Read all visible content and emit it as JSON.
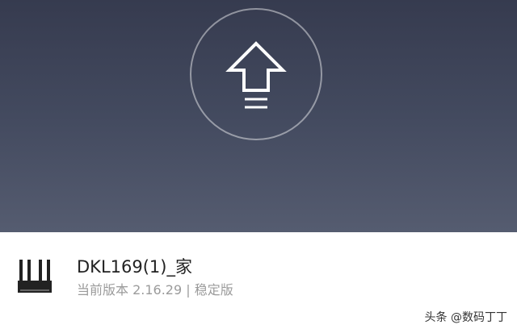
{
  "hero": {
    "upgrade_icon": "upload-arrow-icon",
    "background_top": "#363b4f",
    "background_bottom": "#555c70"
  },
  "device": {
    "icon": "router-icon",
    "name": "DKL169(1)_家",
    "version_label": "当前版本 2.16.29 | 稳定版"
  },
  "watermark": {
    "text": "头条 @数码丁丁"
  }
}
